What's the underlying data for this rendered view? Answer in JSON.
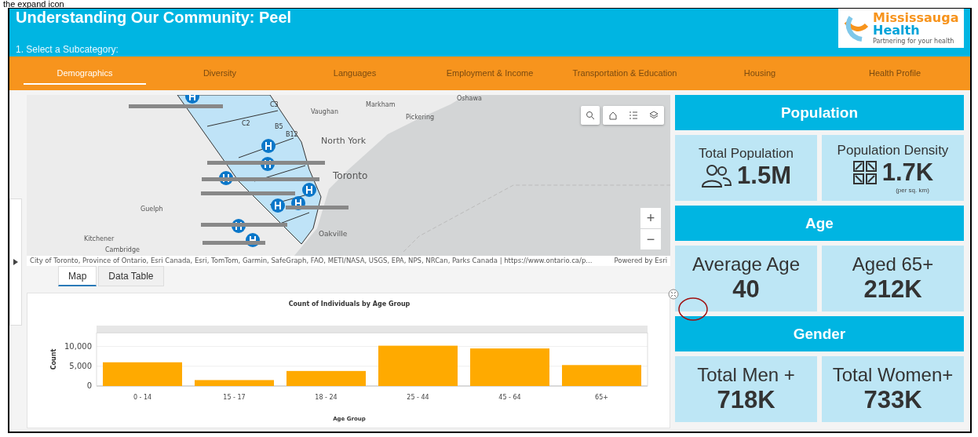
{
  "doc_caption": "the expand icon",
  "header": {
    "title": "Understanding Our Community: Peel",
    "subtitle": "1. Select a Subcategory:",
    "logo": {
      "name_line1": "Mississauga",
      "name_line2": "Health",
      "tagline": "Partnering for your health"
    }
  },
  "nav_tabs": [
    {
      "label": "Demographics",
      "selected": true
    },
    {
      "label": "Diversity",
      "selected": false
    },
    {
      "label": "Languages",
      "selected": false
    },
    {
      "label": "Employment & Income",
      "selected": false
    },
    {
      "label": "Transportation & Education",
      "selected": false
    },
    {
      "label": "Housing",
      "selected": false
    },
    {
      "label": "Health Profile",
      "selected": false
    }
  ],
  "map": {
    "place_labels": [
      "Oshawa",
      "Markham",
      "Vaughan",
      "Pickering",
      "North York",
      "Toronto",
      "Guelph",
      "Kitchener",
      "Oakville",
      "Cambridge"
    ],
    "region_labels": [
      "C3",
      "C2",
      "B5",
      "B12"
    ],
    "attribution": "City of Toronto, Province of Ontario, Esri Canada, Esri, TomTom, Garmin, SafeGraph, FAO, METI/NASA, USGS, EPA, NPS, NRCan, Parks Canada | https://www.ontario.ca/p...",
    "powered_by": "Powered by Esri",
    "zoom_in": "+",
    "zoom_out": "−"
  },
  "view_tabs": [
    {
      "label": "Map",
      "selected": true
    },
    {
      "label": "Data Table",
      "selected": false
    }
  ],
  "chart": {
    "chart_data": {
      "type": "bar",
      "title": "Count of Individuals by Age Group",
      "xlabel": "Age Group",
      "ylabel": "Count",
      "categories": [
        "0 - 14",
        "15 - 17",
        "18 - 24",
        "25 - 44",
        "45 - 64",
        "65+"
      ],
      "series": [
        {
          "color": "#ffaa00",
          "values": [
            6000,
            1500,
            3800,
            10200,
            9500,
            5300
          ]
        }
      ],
      "ylim": [
        0,
        13500
      ],
      "yticks": [
        {
          "value": 0,
          "label": "0"
        },
        {
          "value": 5000,
          "label": "5,000"
        },
        {
          "value": 10000,
          "label": "10,000"
        }
      ]
    }
  },
  "sections": [
    {
      "title": "Population",
      "cards": [
        {
          "label": "Total Population",
          "value": "1.5M",
          "kind": "people"
        },
        {
          "label": "Population Density",
          "value": "1.7K",
          "note": "(per sq. km)",
          "kind": "grid"
        }
      ]
    },
    {
      "title": "Age",
      "cards": [
        {
          "label": "Average Age",
          "value": "40"
        },
        {
          "label": "Aged 65+",
          "value": "212K"
        }
      ]
    },
    {
      "title": "Gender",
      "cards": [
        {
          "label": "Total Men +",
          "value": "718K"
        },
        {
          "label": "Total Women+",
          "value": "733K"
        }
      ]
    }
  ]
}
